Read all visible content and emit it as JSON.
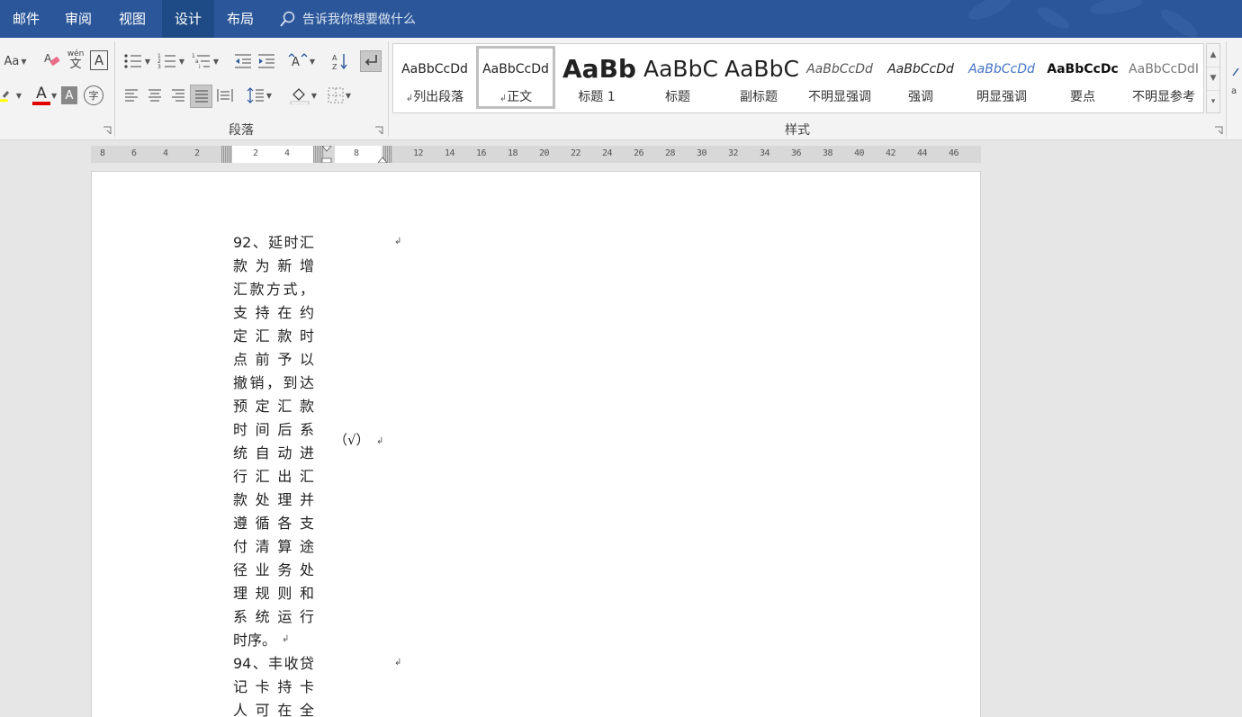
{
  "tabs": [
    {
      "label": "邮件",
      "active": false
    },
    {
      "label": "审阅",
      "active": false
    },
    {
      "label": "视图",
      "active": false
    },
    {
      "label": "设计",
      "active": true
    },
    {
      "label": "布局",
      "active": false
    }
  ],
  "tell_me": {
    "placeholder": "告诉我你想要做什么",
    "icon": "lightbulb-icon"
  },
  "ribbon": {
    "font_group": {
      "change_case_label": "Aa",
      "phonetic_top": "wén",
      "phonetic_bottom": "文",
      "char_border": "A",
      "font_color_letter": "A",
      "char_shading": "A",
      "enclose_char": "字"
    },
    "paragraph_group": {
      "label": "段落"
    },
    "styles_group": {
      "label": "样式",
      "items": [
        {
          "preview": "AaBbCcDd",
          "name": "列出段落",
          "mark": "↲",
          "selected": false
        },
        {
          "preview": "AaBbCcDd",
          "name": "正文",
          "mark": "↲",
          "selected": true
        },
        {
          "preview": "AaBb",
          "name": "标题 1",
          "mark": "",
          "selected": false
        },
        {
          "preview": "AaBbC",
          "name": "标题",
          "mark": "",
          "selected": false
        },
        {
          "preview": "AaBbC",
          "name": "副标题",
          "mark": "",
          "selected": false
        },
        {
          "preview": "AaBbCcDd",
          "name": "不明显强调",
          "mark": "",
          "selected": false
        },
        {
          "preview": "AaBbCcDd",
          "name": "强调",
          "mark": "",
          "selected": false
        },
        {
          "preview": "AaBbCcDd",
          "name": "明显强调",
          "mark": "",
          "selected": false
        },
        {
          "preview": "AaBbCcDc",
          "name": "要点",
          "mark": "",
          "selected": false
        },
        {
          "preview": "AaBbCcDdI",
          "name": "不明显参考",
          "mark": "",
          "selected": false
        }
      ]
    }
  },
  "ruler": {
    "ticks": [
      "8",
      "6",
      "4",
      "2",
      "",
      "2",
      "4",
      "",
      "8",
      "",
      "12",
      "14",
      "16",
      "18",
      "20",
      "22",
      "24",
      "26",
      "28",
      "30",
      "32",
      "34",
      "36",
      "38",
      "40",
      "42",
      "44",
      "46"
    ]
  },
  "document": {
    "item92": {
      "lines": [
        "92、延时汇",
        "款为新增",
        "汇款方式，",
        "支持在约",
        "定汇款时",
        "点前予以",
        "撤销，到达",
        "预定汇款",
        "时间后系",
        "统自动进",
        "行汇出汇",
        "款处理并",
        "遵循各支",
        "付清算途",
        "径业务处",
        "理规则和",
        "系统运行",
        "时序。"
      ],
      "answer": "（√）"
    },
    "item94": {
      "lines": [
        "94、丰收贷",
        "记卡持卡",
        "人可在全"
      ]
    },
    "para_mark": "↲"
  },
  "colors": {
    "accent": "#2b579a",
    "font_color_bar": "#e00000",
    "highlight_bar": "#ffff00"
  }
}
